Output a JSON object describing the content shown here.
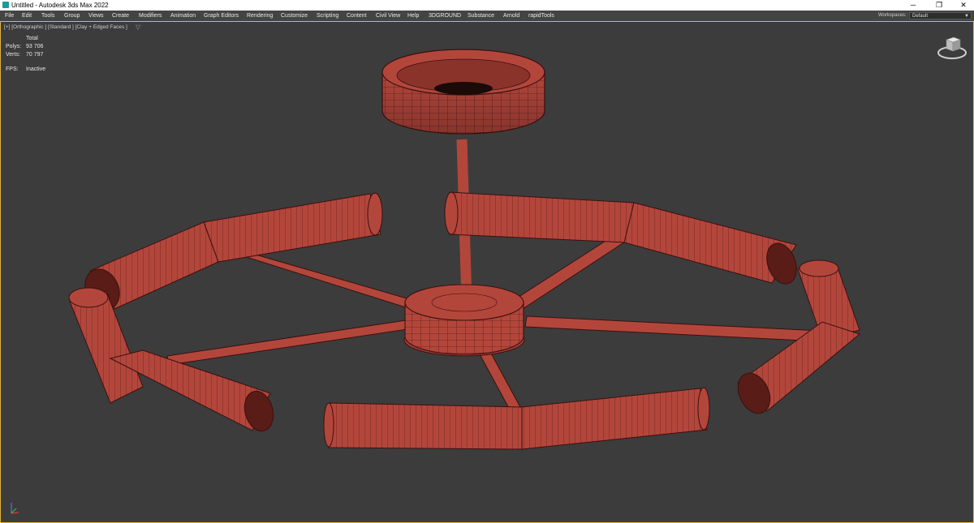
{
  "window": {
    "title": "Untitled - Autodesk 3ds Max 2022",
    "controls": {
      "minimize": "─",
      "restore": "❐",
      "close": "✕"
    }
  },
  "menu": {
    "items": [
      "File",
      "Edit",
      "Tools",
      "Group",
      "Views",
      "Create",
      "Modifiers",
      "Animation",
      "Graph Editors",
      "Rendering",
      "Customize",
      "Scripting",
      "Content",
      "Civil View",
      "Help",
      "3DGROUND",
      "Substance",
      "Arnold",
      "rapidTools"
    ],
    "workspaces_label": "Workspaces:",
    "workspaces_value": "Default"
  },
  "viewport": {
    "label": "[+] [Orthographic ] [Standard ] [Clay + Edged Faces ]",
    "filter_icon": "funnel-icon",
    "stats": {
      "total_header": "Total",
      "polys_label": "Polys:",
      "polys_value": "93 706",
      "verts_label": "Verts:",
      "verts_value": "70 797",
      "fps_label": "FPS:",
      "fps_value": "Inactive"
    },
    "active_border_color": "#e0b43c",
    "model_color": "#b5473d",
    "wire_color": "#3a1010"
  }
}
